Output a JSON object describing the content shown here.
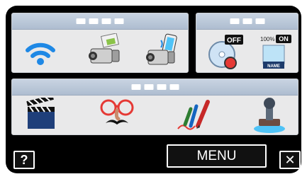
{
  "panels": {
    "network": {
      "label": ""
    },
    "settings": {
      "label": ""
    },
    "effects": {
      "label": ""
    }
  },
  "icons": {
    "wifi": "wifi-icon",
    "camera_transfer": "camera-transfer-icon",
    "camera_phone": "camera-phone-icon",
    "disc_off": "disc-off-icon",
    "name_on": "name-on-icon",
    "clapperboard": "clapperboard-icon",
    "funny_face": "funny-face-icon",
    "pens": "pens-icon",
    "stamp": "stamp-icon"
  },
  "badges": {
    "off": "OFF",
    "on": "ON",
    "percent": "100%",
    "name": "NAME"
  },
  "buttons": {
    "help": "?",
    "menu": "MENU",
    "close": "✕"
  },
  "colors": {
    "wifi": "#1e88e5",
    "accent_red": "#e53935",
    "panel_header": "#b9c6d6"
  }
}
